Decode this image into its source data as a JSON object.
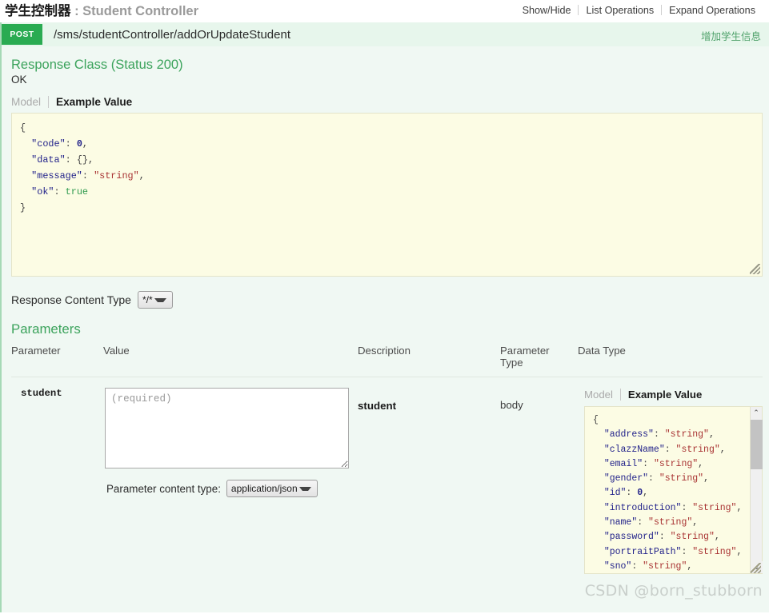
{
  "resource": {
    "title_cn": "学生控制器",
    "title_colon": " : ",
    "title_en": "Student Controller",
    "links": [
      {
        "label": "Show/Hide"
      },
      {
        "label": "List Operations"
      },
      {
        "label": "Expand Operations"
      }
    ]
  },
  "operation": {
    "method": "POST",
    "path": "/sms/studentController/addOrUpdateStudent",
    "summary": "增加学生信息"
  },
  "response": {
    "class_title": "Response Class (Status 200)",
    "status_text": "OK",
    "tabs": {
      "model": "Model",
      "example": "Example Value"
    },
    "example_lines": [
      {
        "indent": 0,
        "parts": [
          {
            "t": "punct",
            "v": "{"
          }
        ]
      },
      {
        "indent": 1,
        "parts": [
          {
            "t": "key",
            "v": "\"code\""
          },
          {
            "t": "punct",
            "v": ": "
          },
          {
            "t": "num",
            "v": "0"
          },
          {
            "t": "punct",
            "v": ","
          }
        ]
      },
      {
        "indent": 1,
        "parts": [
          {
            "t": "key",
            "v": "\"data\""
          },
          {
            "t": "punct",
            "v": ": "
          },
          {
            "t": "punct",
            "v": "{}"
          },
          {
            "t": "punct",
            "v": ","
          }
        ]
      },
      {
        "indent": 1,
        "parts": [
          {
            "t": "key",
            "v": "\"message\""
          },
          {
            "t": "punct",
            "v": ": "
          },
          {
            "t": "str",
            "v": "\"string\""
          },
          {
            "t": "punct",
            "v": ","
          }
        ]
      },
      {
        "indent": 1,
        "parts": [
          {
            "t": "key",
            "v": "\"ok\""
          },
          {
            "t": "punct",
            "v": ": "
          },
          {
            "t": "bool",
            "v": "true"
          }
        ]
      },
      {
        "indent": 0,
        "parts": [
          {
            "t": "punct",
            "v": "}"
          }
        ]
      }
    ],
    "content_type_label": "Response Content Type",
    "content_type_value": "*/*",
    "content_type_options": [
      "*/*"
    ]
  },
  "parameters": {
    "title": "Parameters",
    "columns": [
      {
        "label": "Parameter"
      },
      {
        "label": "Value"
      },
      {
        "label": "Description"
      },
      {
        "label": "Parameter\nType",
        "line1": "Parameter",
        "line2": "Type"
      },
      {
        "label": "Data Type"
      }
    ],
    "rows": [
      {
        "name": "student",
        "value": "",
        "placeholder": "(required)",
        "description": "student",
        "param_type": "body",
        "content_type_label": "Parameter content type:",
        "content_type_value": "application/json",
        "content_type_options": [
          "application/json"
        ],
        "data_type": {
          "tabs": {
            "model": "Model",
            "example": "Example Value"
          },
          "example_lines": [
            {
              "indent": 0,
              "parts": [
                {
                  "t": "punct",
                  "v": "{"
                }
              ]
            },
            {
              "indent": 1,
              "parts": [
                {
                  "t": "key",
                  "v": "\"address\""
                },
                {
                  "t": "punct",
                  "v": ": "
                },
                {
                  "t": "str",
                  "v": "\"string\""
                },
                {
                  "t": "punct",
                  "v": ","
                }
              ]
            },
            {
              "indent": 1,
              "parts": [
                {
                  "t": "key",
                  "v": "\"clazzName\""
                },
                {
                  "t": "punct",
                  "v": ": "
                },
                {
                  "t": "str",
                  "v": "\"string\""
                },
                {
                  "t": "punct",
                  "v": ","
                }
              ]
            },
            {
              "indent": 1,
              "parts": [
                {
                  "t": "key",
                  "v": "\"email\""
                },
                {
                  "t": "punct",
                  "v": ": "
                },
                {
                  "t": "str",
                  "v": "\"string\""
                },
                {
                  "t": "punct",
                  "v": ","
                }
              ]
            },
            {
              "indent": 1,
              "parts": [
                {
                  "t": "key",
                  "v": "\"gender\""
                },
                {
                  "t": "punct",
                  "v": ": "
                },
                {
                  "t": "str",
                  "v": "\"string\""
                },
                {
                  "t": "punct",
                  "v": ","
                }
              ]
            },
            {
              "indent": 1,
              "parts": [
                {
                  "t": "key",
                  "v": "\"id\""
                },
                {
                  "t": "punct",
                  "v": ": "
                },
                {
                  "t": "num",
                  "v": "0"
                },
                {
                  "t": "punct",
                  "v": ","
                }
              ]
            },
            {
              "indent": 1,
              "parts": [
                {
                  "t": "key",
                  "v": "\"introduction\""
                },
                {
                  "t": "punct",
                  "v": ": "
                },
                {
                  "t": "str",
                  "v": "\"string\""
                },
                {
                  "t": "punct",
                  "v": ","
                }
              ]
            },
            {
              "indent": 1,
              "parts": [
                {
                  "t": "key",
                  "v": "\"name\""
                },
                {
                  "t": "punct",
                  "v": ": "
                },
                {
                  "t": "str",
                  "v": "\"string\""
                },
                {
                  "t": "punct",
                  "v": ","
                }
              ]
            },
            {
              "indent": 1,
              "parts": [
                {
                  "t": "key",
                  "v": "\"password\""
                },
                {
                  "t": "punct",
                  "v": ": "
                },
                {
                  "t": "str",
                  "v": "\"string\""
                },
                {
                  "t": "punct",
                  "v": ","
                }
              ]
            },
            {
              "indent": 1,
              "parts": [
                {
                  "t": "key",
                  "v": "\"portraitPath\""
                },
                {
                  "t": "punct",
                  "v": ": "
                },
                {
                  "t": "str",
                  "v": "\"string\""
                },
                {
                  "t": "punct",
                  "v": ","
                }
              ]
            },
            {
              "indent": 1,
              "parts": [
                {
                  "t": "key",
                  "v": "\"sno\""
                },
                {
                  "t": "punct",
                  "v": ": "
                },
                {
                  "t": "str",
                  "v": "\"string\""
                },
                {
                  "t": "punct",
                  "v": ","
                }
              ]
            }
          ],
          "scrollbar": {
            "up_arrow": "⌃",
            "down_arrow": "⌄"
          }
        }
      }
    ]
  },
  "watermark": "CSDN @born_stubborn",
  "colors": {
    "method_post": "#2aab52",
    "accent_green": "#3ca35c",
    "op_header_bg": "#e7f6ec",
    "op_body_bg": "#f0f8f3",
    "code_bg": "#fcfce4",
    "string_token": "#a83232",
    "key_token": "#22228a",
    "bool_token": "#2e9a4e"
  }
}
